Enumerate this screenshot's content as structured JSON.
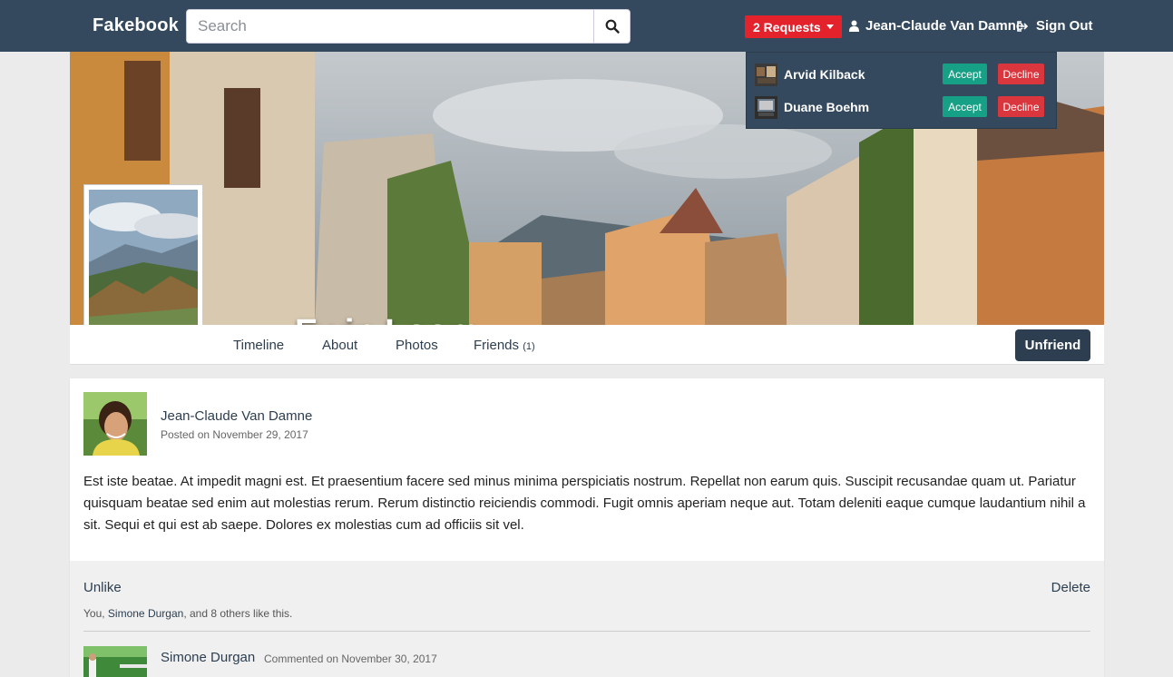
{
  "navbar": {
    "brand": "Fakebook",
    "search_placeholder": "Search",
    "requests_label": "2 Requests",
    "user_name": "Jean-Claude Van Damne",
    "sign_out_label": "Sign Out"
  },
  "friend_requests": [
    {
      "name": "Arvid Kilback",
      "accept_label": "Accept",
      "decline_label": "Decline"
    },
    {
      "name": "Duane Boehm",
      "accept_label": "Accept",
      "decline_label": "Decline"
    }
  ],
  "profile": {
    "name": "Ewin Loom",
    "tabs": [
      {
        "label": "Timeline"
      },
      {
        "label": "About"
      },
      {
        "label": "Photos"
      },
      {
        "label": "Friends",
        "count": "(1)"
      }
    ],
    "unfriend_label": "Unfriend"
  },
  "post": {
    "author": "Jean-Claude Van Damne",
    "date": "Posted on November 29, 2017",
    "body": "Est iste beatae. At impedit magni est. Et praesentium facere sed minus minima perspiciatis nostrum. Repellat non earum quis. Suscipit recusandae quam ut. Pariatur quisquam beatae sed enim aut molestias rerum. Rerum distinctio reiciendis commodi. Fugit omnis aperiam neque aut. Totam deleniti eaque cumque laudantium nihil a sit. Sequi et qui est ab saepe. Dolores ex molestias cum ad officiis sit vel.",
    "unlike_label": "Unlike",
    "delete_label": "Delete",
    "likes_prefix": "You, ",
    "likes_name": "Simone Durgan",
    "likes_suffix": ", and 8 others like this."
  },
  "comment": {
    "author": "Simone Durgan",
    "date": "Commented on November 30, 2017"
  },
  "colors": {
    "navbar": "#34495e",
    "requests_badge": "#e4222c",
    "accept": "#16a085",
    "decline": "#d9363e",
    "unfriend": "#2c3e50",
    "link": "#2c3e50"
  },
  "icons": [
    "search-icon",
    "caret-down-icon",
    "user-icon",
    "sign-out-icon"
  ]
}
